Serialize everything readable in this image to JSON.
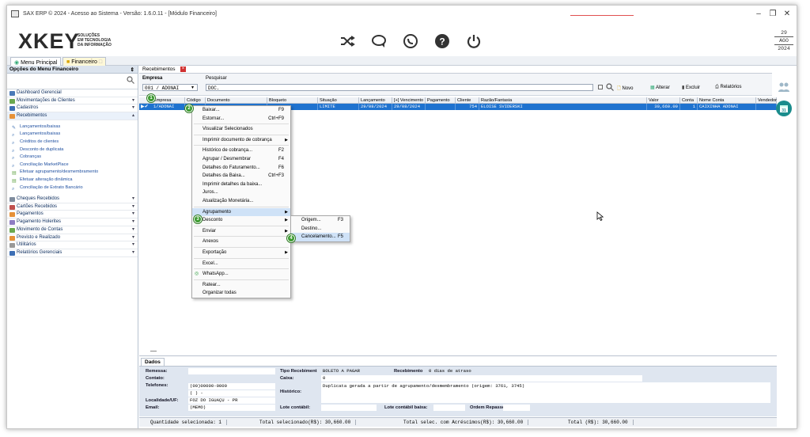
{
  "window": {
    "title": "SAX ERP © 2024 - Acesso ao Sistema - Versão: 1.6.0.11 - [Módulo Financeiro]",
    "min": "–",
    "max": "❐",
    "close": "✕"
  },
  "header": {
    "logo": "XKEY",
    "logo_sub": [
      "SOLUÇÕES",
      "EM TECNOLOGIA",
      "DA INFORMAÇÃO"
    ],
    "icons": [
      "shuffle-icon",
      "chat-icon",
      "whatsapp-icon",
      "help-icon",
      "power-icon"
    ],
    "date": {
      "day": "29",
      "month": "AGO",
      "year": "2024"
    }
  },
  "tabs": [
    {
      "label": "Menu Principal"
    },
    {
      "label": "Financeiro"
    }
  ],
  "sidebar": {
    "title": "Opções do Menu Financeiro",
    "pin": "⇕",
    "items": [
      {
        "label": "Dashboard Gerencial",
        "color": "#4a7ab8"
      },
      {
        "label": "Movimentações de Clientes",
        "color": "#6aa84f"
      },
      {
        "label": "Cadastros",
        "color": "#3d6fb5"
      },
      {
        "label": "Recebimentos",
        "color": "#e69138"
      }
    ],
    "sub_items": [
      {
        "label": "Lançamentos/baixas",
        "icon": "✎"
      },
      {
        "label": "Lançamentos/baixas",
        "icon": "⌕"
      },
      {
        "label": "Créditos de clientes",
        "icon": "⌕"
      },
      {
        "label": "Desconto de duplicata",
        "icon": "⌕"
      },
      {
        "label": "Cobranças",
        "icon": "⌕"
      },
      {
        "label": "Conciliação MarketPlace",
        "icon": "⌕"
      },
      {
        "label": "Efetuar agrupamento/desmembramento",
        "icon": "▤"
      },
      {
        "label": "Efetuar alteração dinâmica",
        "icon": "▤"
      },
      {
        "label": "Conciliação de Extrato Bancário",
        "icon": "⌕"
      }
    ],
    "bottom_items": [
      {
        "label": "Cheques Recebidos",
        "color": "#7f8c9d"
      },
      {
        "label": "Cartões Recebidos",
        "color": "#c0504d"
      },
      {
        "label": "Pagamentos",
        "color": "#e69138"
      },
      {
        "label": "Pagamento Holerites",
        "color": "#8e7cc3"
      },
      {
        "label": "Movimento de Contas",
        "color": "#6aa84f"
      },
      {
        "label": "Previsto e Realizado",
        "color": "#e69138"
      },
      {
        "label": "Utilitários",
        "color": "#999999"
      },
      {
        "label": "Relatórios Gerenciais",
        "color": "#3d6fb5"
      }
    ]
  },
  "main": {
    "tab_label": "Recebimentos",
    "empresa_label": "Empresa",
    "empresa_value": "001 / ADONAI",
    "pesquisar_label": "Pesquisar",
    "pesquisar_value": "DOC.",
    "buttons": {
      "novo": "Novo",
      "alterar": "Alterar",
      "excluir": "Excluir",
      "relatorios": "Relatórios"
    }
  },
  "grid": {
    "columns": [
      "Empresa",
      "Código",
      "Documento",
      "Bloqueto",
      "Situação",
      "Lançamento",
      "[+] Vencimento",
      "Pagamento",
      "Cliente",
      "Razão/Fantasia",
      "Valor",
      "Conta",
      "Nome Conta",
      "Vendedor"
    ],
    "row": [
      "1/ADONAI",
      "",
      "",
      "",
      "LIMITE",
      "29/08/2024",
      "29/08/2024",
      "",
      "754",
      "ELOISE SVIDERSKI",
      "30,660.00",
      "1",
      "CAIXINHA ADONAI",
      ""
    ]
  },
  "context_menu": {
    "items": [
      {
        "label": "Baixar...",
        "shortcut": "F9"
      },
      {
        "label": "Estornar...",
        "shortcut": "Ctrl+F9"
      },
      {
        "sep": true
      },
      {
        "label": "Visualizar Selecionados",
        "shortcut": ""
      },
      {
        "sep": true
      },
      {
        "label": "Imprimir documento de cobrança",
        "shortcut": "",
        "arrow": "▶"
      },
      {
        "sep": true
      },
      {
        "label": "Histórico de cobrança...",
        "shortcut": "F2"
      },
      {
        "label": "Agrupar / Desmembrar",
        "shortcut": "F4"
      },
      {
        "label": "Detalhes do Faturamento...",
        "shortcut": "F6"
      },
      {
        "label": "Detalhes da Baixa...",
        "shortcut": "Ctrl+F3"
      },
      {
        "label": "Imprimir detalhes da baixa...",
        "shortcut": ""
      },
      {
        "label": "Juros...",
        "shortcut": ""
      },
      {
        "label": "Atualização Monetária...",
        "shortcut": ""
      },
      {
        "sep": true
      },
      {
        "label": "Agrupamento",
        "shortcut": "",
        "arrow": "▶",
        "hl": true
      },
      {
        "label": "Desconto",
        "shortcut": "",
        "arrow": "▶"
      },
      {
        "sep": true
      },
      {
        "label": "Enviar",
        "shortcut": "",
        "arrow": "▶"
      },
      {
        "sep": true
      },
      {
        "label": "Anexos",
        "shortcut": ""
      },
      {
        "sep": true
      },
      {
        "label": "Exportação",
        "shortcut": "",
        "arrow": "▶"
      },
      {
        "sep": true
      },
      {
        "label": "Excel...",
        "shortcut": ""
      },
      {
        "sep": true
      },
      {
        "label": "WhatsApp...",
        "shortcut": ""
      },
      {
        "sep": true
      },
      {
        "label": "Ratear...",
        "shortcut": ""
      },
      {
        "label": "Organizar todas",
        "shortcut": ""
      }
    ]
  },
  "submenu": {
    "items": [
      {
        "label": "Origem...",
        "shortcut": "F3"
      },
      {
        "label": "Destino...",
        "shortcut": ""
      },
      {
        "label": "Cancelamento...",
        "shortcut": "F5",
        "hl": true
      }
    ]
  },
  "badges": [
    "1",
    "2",
    "3",
    "4"
  ],
  "dados": {
    "tab": "Dados",
    "remessa_label": "Remessa:",
    "contato_label": "Contato:",
    "telefones_label": "Telefones:",
    "telefone1": "(00)00000-0000",
    "telefone2": "(  )      -",
    "localidade_label": "Localidade/UF:",
    "localidade_value": "FOZ DO IGUAÇU - PR",
    "email_label": "Email:",
    "email_value": "(MEMO)",
    "tipo_label": "Tipo Recebiment",
    "tipo_value": "BOLETO A PAGAR",
    "recebimento_label": "Recebimento",
    "recebimento_value": "0 dias de atraso",
    "caixa_label": "Caixa:",
    "caixa_value": "0",
    "historico_label": "Histórico:",
    "historico_value": "Duplicata gerada a partir de agrupamento/desmembramento  (origem:  3761, 3745)",
    "lote_contabil_label": "Lote contábil:",
    "lote_baixa_label": "Lote contábil baixa:",
    "ordem_label": "Ordem Repasse:"
  },
  "status": {
    "qtd": "Quantidade selecionada: 1",
    "total_sel": "Total selecionado(R$): 30,660.00",
    "total_acr": "Total selec. com Acréscimos(R$): 30,660.00",
    "total": "Total (R$): 30,660.00"
  }
}
